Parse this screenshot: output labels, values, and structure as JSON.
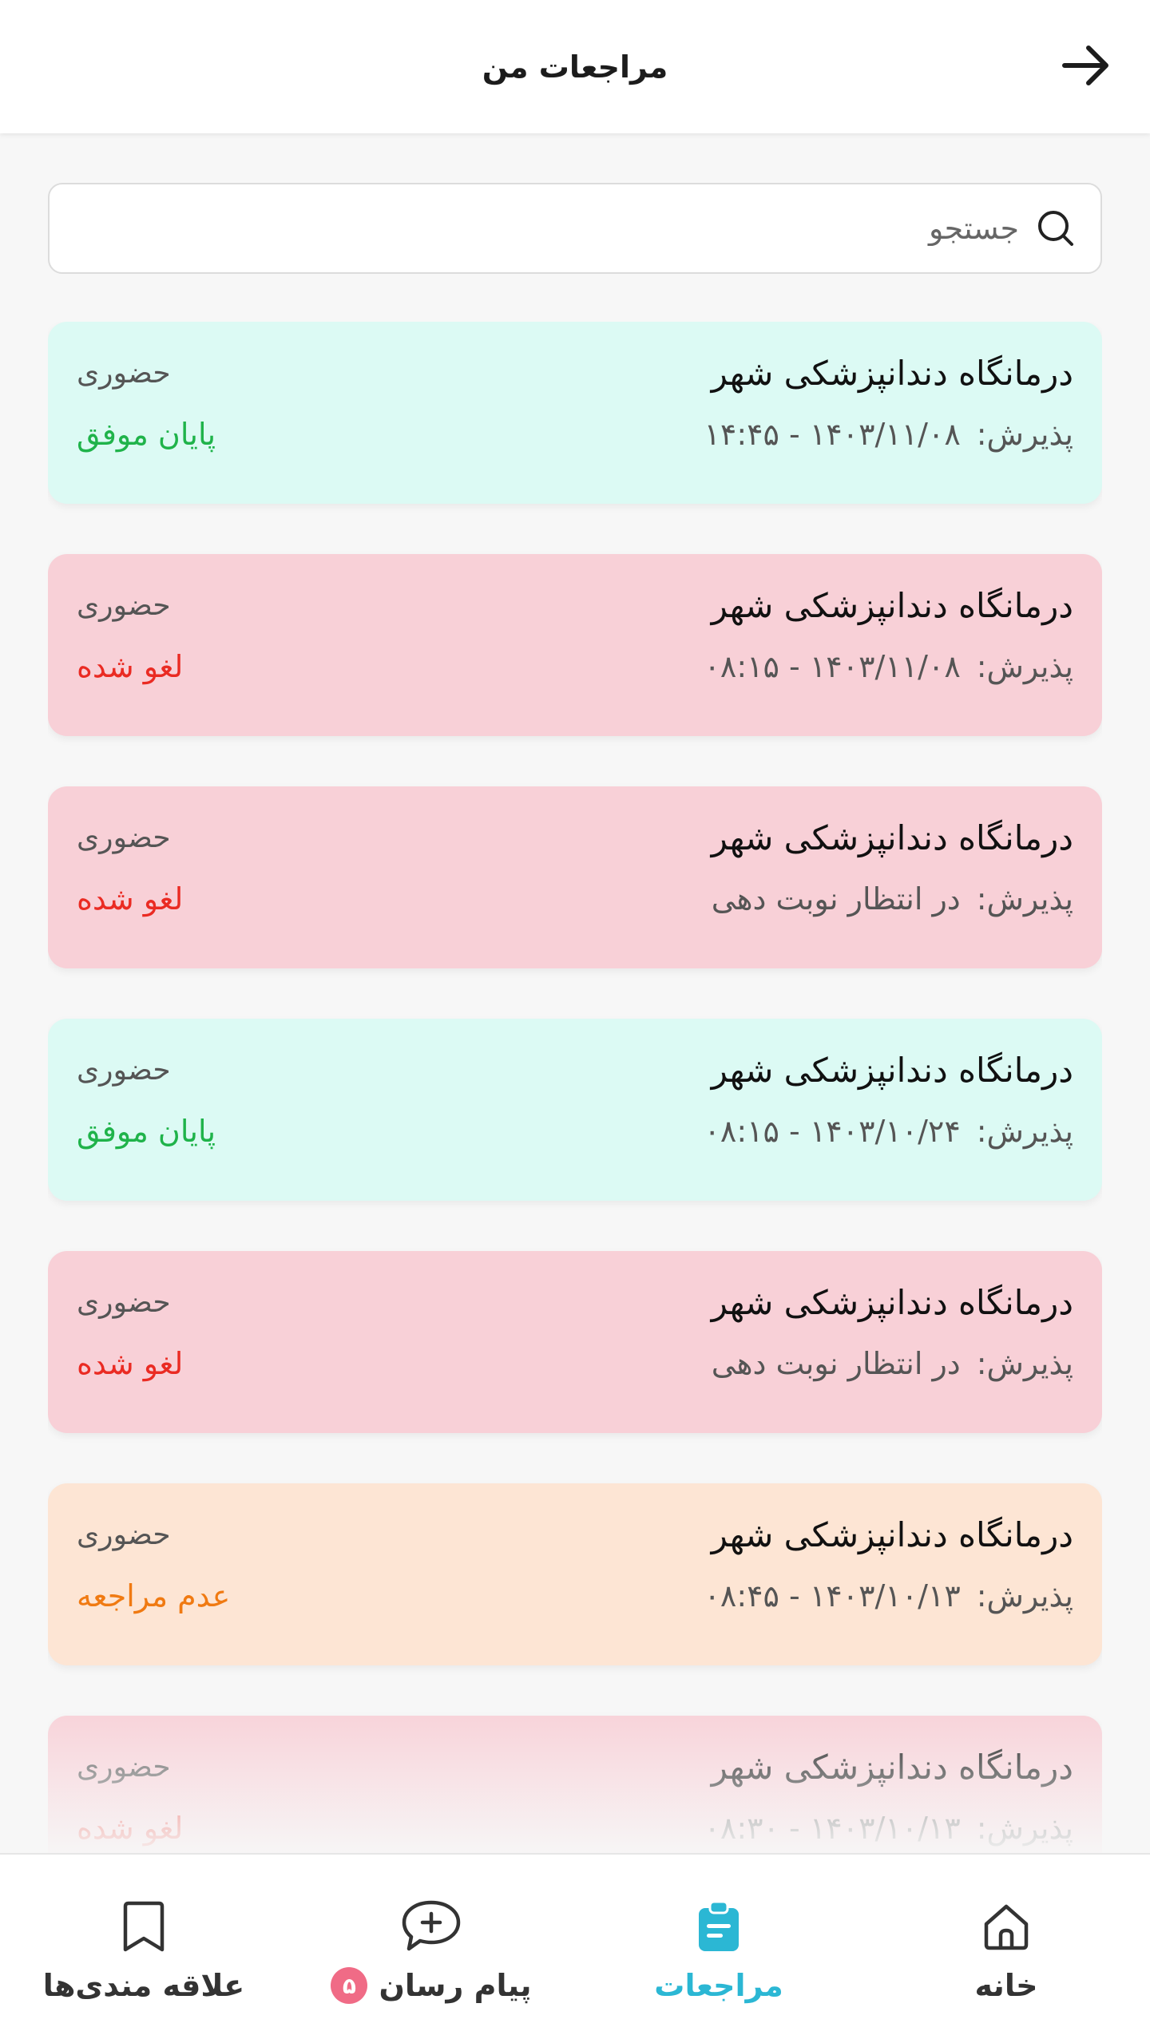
{
  "header": {
    "title": "مراجعات من"
  },
  "search": {
    "placeholder": "جستجو"
  },
  "appointments": [
    {
      "clinic": "درمانگاه دندانپزشکی شهر",
      "kind": "حضوری",
      "reception_label": "پذیرش:",
      "reception_value": "۱۴۰۳/۱۱/۰۸ - ۱۴:۴۵",
      "status": "پایان موفق",
      "status_type": "success"
    },
    {
      "clinic": "درمانگاه دندانپزشکی شهر",
      "kind": "حضوری",
      "reception_label": "پذیرش:",
      "reception_value": "۱۴۰۳/۱۱/۰۸ - ۰۸:۱۵",
      "status": "لغو شده",
      "status_type": "canceled"
    },
    {
      "clinic": "درمانگاه دندانپزشکی شهر",
      "kind": "حضوری",
      "reception_label": "پذیرش:",
      "reception_value": "در انتظار نوبت دهی",
      "status": "لغو شده",
      "status_type": "canceled"
    },
    {
      "clinic": "درمانگاه دندانپزشکی شهر",
      "kind": "حضوری",
      "reception_label": "پذیرش:",
      "reception_value": "۱۴۰۳/۱۰/۲۴ - ۰۸:۱۵",
      "status": "پایان موفق",
      "status_type": "success"
    },
    {
      "clinic": "درمانگاه دندانپزشکی شهر",
      "kind": "حضوری",
      "reception_label": "پذیرش:",
      "reception_value": "در انتظار نوبت دهی",
      "status": "لغو شده",
      "status_type": "canceled"
    },
    {
      "clinic": "درمانگاه دندانپزشکی شهر",
      "kind": "حضوری",
      "reception_label": "پذیرش:",
      "reception_value": "۱۴۰۳/۱۰/۱۳ - ۰۸:۴۵",
      "status": "عدم مراجعه",
      "status_type": "noshow"
    },
    {
      "clinic": "درمانگاه دندانپزشکی شهر",
      "kind": "حضوری",
      "reception_label": "پذیرش:",
      "reception_value": "۱۴۰۳/۱۰/۱۳ - ۰۸:۳۰",
      "status": "لغو شده",
      "status_type": "canceled"
    }
  ],
  "bottom_nav": {
    "home": "خانه",
    "visits": "مراجعات",
    "messenger": "پیام رسان",
    "messenger_badge": "۵",
    "favorites": "علاقه مندی‌ها"
  },
  "colors": {
    "accent": "#2bb7d4",
    "success_bg": "#dcfaf4",
    "canceled_bg": "#f8d0d7",
    "noshow_bg": "#fde5d4",
    "success_text": "#1fb34a",
    "canceled_text": "#ea2b23",
    "noshow_text": "#f07a12",
    "badge": "#f06b86"
  }
}
